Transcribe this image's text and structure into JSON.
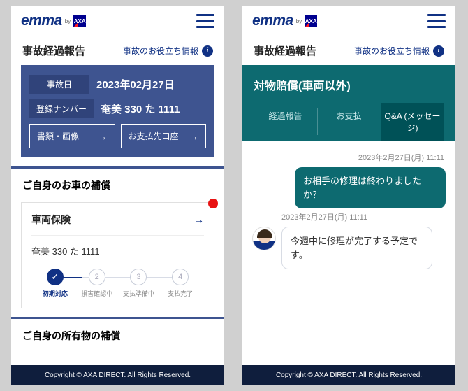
{
  "brand": {
    "logo_text": "emma",
    "by": "by"
  },
  "sub": {
    "title": "事故経過報告",
    "info": "事故のお役立ち情報"
  },
  "left": {
    "date_label": "事故日",
    "date_value": "2023年02月27日",
    "reg_label": "登録ナンバー",
    "reg_value": "奄美 330 た 1111",
    "btn_docs": "書類・画像",
    "btn_bank": "お支払先口座",
    "sec1": "ご自身のお車の補償",
    "card_title": "車両保険",
    "card_sub": "奄美 330 た 1111",
    "steps": [
      "初期対応",
      "損害確認中",
      "支払準備中",
      "支払完了"
    ],
    "sec2": "ご自身の所有物の補償"
  },
  "right": {
    "hero": "対物賠償(車両以外)",
    "tabs": [
      "経過報告",
      "お支払",
      "Q&A (メッセージ)"
    ],
    "ts1": "2023年2月27日(月) 11:11",
    "m1": "お相手の修理は終わりましたか？",
    "ts2": "2023年2月27日(月) 11:11",
    "m2": "今週中に修理が完了する予定です。"
  },
  "footer": "Copyright © AXA DIRECT. All Rights Reserved."
}
